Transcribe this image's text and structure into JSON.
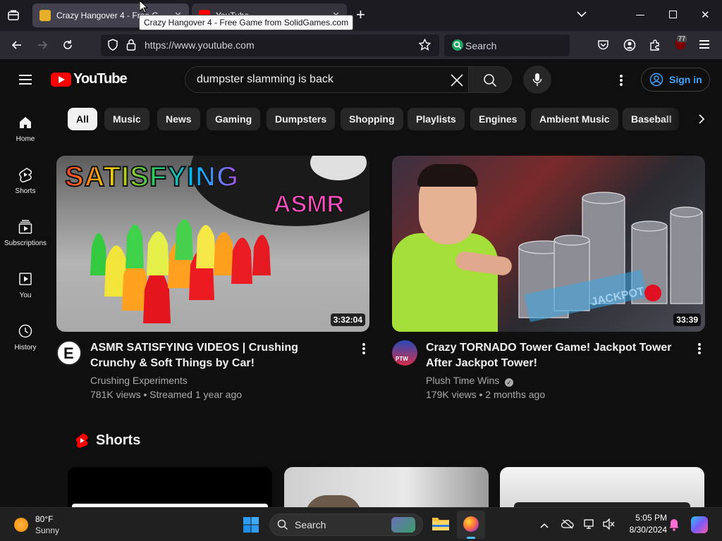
{
  "browser": {
    "tabs": [
      {
        "title": "Crazy Hangover 4 - Free Game from SolidGames.com",
        "short": "Crazy Hangover 4 - Free G"
      },
      {
        "title": "YouTube",
        "short": "YouTube"
      }
    ],
    "tooltip": "Crazy Hangover 4 - Free Game from SolidGames.com",
    "url": "https://www.youtube.com",
    "search_placeholder": "Search",
    "extension_badge": "77"
  },
  "youtube": {
    "logo_text": "YouTube",
    "search_value": "dumpster slamming is back",
    "signin_label": "Sign in",
    "guide": [
      {
        "label": "Home"
      },
      {
        "label": "Shorts"
      },
      {
        "label": "Subscriptions"
      },
      {
        "label": "You"
      },
      {
        "label": "History"
      }
    ],
    "chips": [
      "All",
      "Music",
      "News",
      "Gaming",
      "Dumpsters",
      "Shopping",
      "Playlists",
      "Engines",
      "Ambient Music",
      "Baseball"
    ],
    "videos": [
      {
        "title": "ASMR SATISFYING VIDEOS | Crushing Crunchy & Soft Things by Car!",
        "channel": "Crushing Experiments",
        "meta": "781K views • Streamed 1 year ago",
        "duration": "3:32:04",
        "thumb_text_1": "SATISFYING",
        "thumb_text_2": "ASMR",
        "avatar_letter": "E"
      },
      {
        "title": "Crazy TORNADO Tower Game! Jackpot Tower After Jackpot Tower!",
        "channel": "Plush Time Wins",
        "meta": "179K views • 2 months ago",
        "duration": "33:39",
        "thumb_text": "JACKPOT",
        "avatar_letter": "PTW"
      }
    ],
    "shorts_title": "Shorts"
  },
  "taskbar": {
    "weather_temp": "80°F",
    "weather_desc": "Sunny",
    "search_label": "Search",
    "time": "5:05 PM",
    "date": "8/30/2024"
  },
  "colors": {
    "yt_red": "#ff0000",
    "link_blue": "#3ea6ff",
    "bg": "#0f0f0f"
  }
}
